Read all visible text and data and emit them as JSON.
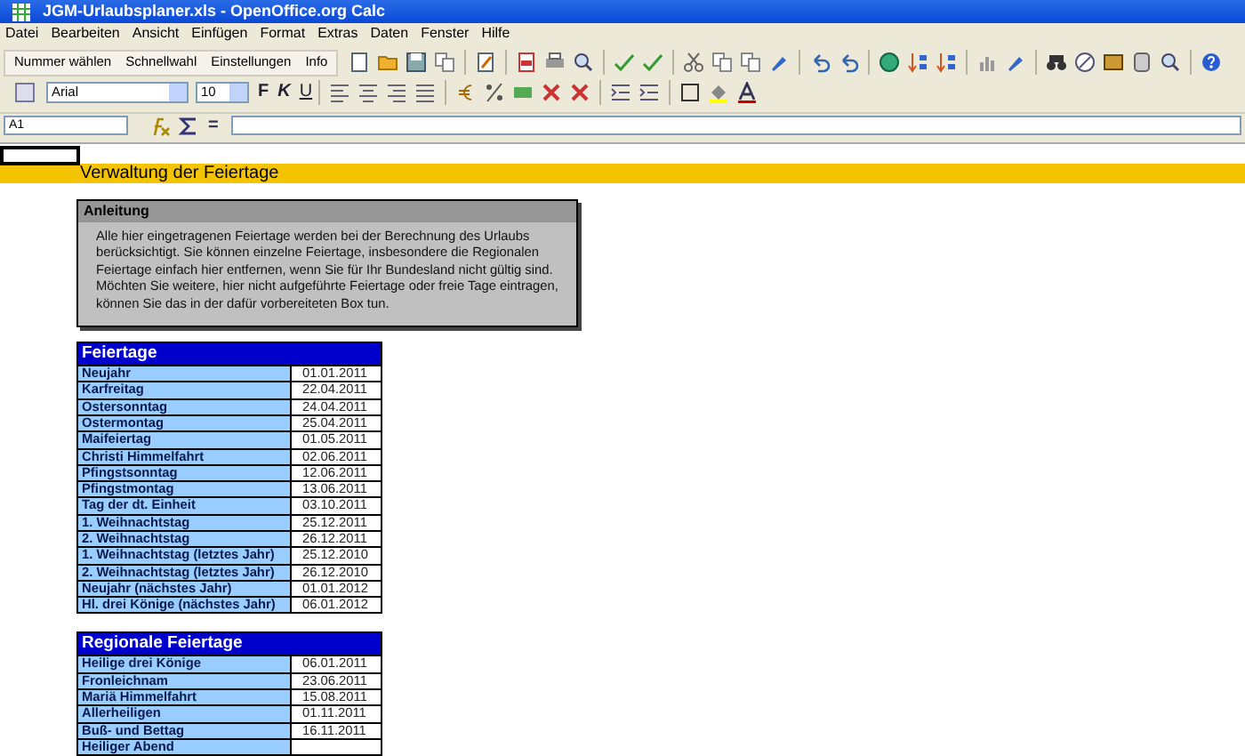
{
  "window": {
    "title": "JGM-Urlaubsplaner.xls - OpenOffice.org Calc"
  },
  "menu": [
    "Datei",
    "Bearbeiten",
    "Ansicht",
    "Einfügen",
    "Format",
    "Extras",
    "Daten",
    "Fenster",
    "Hilfe"
  ],
  "custom_toolbar": [
    "Nummer wählen",
    "Schnellwahl",
    "Einstellungen",
    "Info"
  ],
  "format_toolbar": {
    "font": "Arial",
    "size": "10",
    "styles": [
      "F",
      "K",
      "U"
    ]
  },
  "formula_bar": {
    "cell": "A1",
    "equals": "="
  },
  "sheet": {
    "heading": "Verwaltung der Feiertage",
    "note": {
      "title": "Anleitung",
      "text": "Alle hier eingetragenen Feiertage werden bei der Berechnung des Urlaubs berücksichtigt. Sie können einzelne Feiertage, insbesondere die Regionalen Feiertage einfach hier entfernen, wenn Sie für Ihr Bundesland nicht gültig sind. Möchten Sie weitere, hier nicht aufgeführte Feiertage oder freie Tage eintragen, können Sie das in der dafür vorbereiteten Box tun."
    },
    "tables": [
      {
        "title": "Feiertage",
        "rows": [
          [
            "Neujahr",
            "01.01.2011"
          ],
          [
            "Karfreitag",
            "22.04.2011"
          ],
          [
            "Ostersonntag",
            "24.04.2011"
          ],
          [
            "Ostermontag",
            "25.04.2011"
          ],
          [
            "Maifeiertag",
            "01.05.2011"
          ],
          [
            "Christi Himmelfahrt",
            "02.06.2011"
          ],
          [
            "Pfingstsonntag",
            "12.06.2011"
          ],
          [
            "Pfingstmontag",
            "13.06.2011"
          ],
          [
            "Tag der dt. Einheit",
            "03.10.2011"
          ],
          [
            "1. Weihnachtstag",
            "25.12.2011"
          ],
          [
            "2. Weihnachtstag",
            "26.12.2011"
          ],
          [
            "1. Weihnachtstag (letztes Jahr)",
            "25.12.2010"
          ],
          [
            "2. Weihnachtstag (letztes Jahr)",
            "26.12.2010"
          ],
          [
            "Neujahr (nächstes Jahr)",
            "01.01.2012"
          ],
          [
            "Hl. drei Könige (nächstes Jahr)",
            "06.01.2012"
          ]
        ]
      },
      {
        "title": "Regionale Feiertage",
        "rows": [
          [
            "Heilige drei Könige",
            "06.01.2011"
          ],
          [
            "Fronleichnam",
            "23.06.2011"
          ],
          [
            "Mariä Himmelfahrt",
            "15.08.2011"
          ],
          [
            "Allerheiligen",
            "01.11.2011"
          ],
          [
            "Buß- und Bettag",
            "16.11.2011"
          ],
          [
            "Heiliger Abend",
            ""
          ]
        ]
      }
    ]
  }
}
